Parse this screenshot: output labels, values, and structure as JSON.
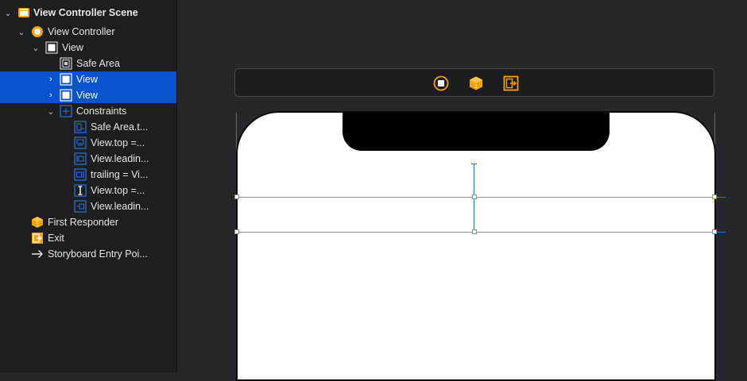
{
  "outline": {
    "items": [
      {
        "label": "View Controller Scene",
        "icon": "scene-icon"
      },
      {
        "label": "View Controller",
        "icon": "view-controller-icon"
      },
      {
        "label": "View",
        "icon": "view-icon"
      },
      {
        "label": "Safe Area",
        "icon": "safe-area-icon"
      },
      {
        "label": "View",
        "icon": "view-icon"
      },
      {
        "label": "View",
        "icon": "view-icon"
      },
      {
        "label": "Constraints",
        "icon": "constraints-icon"
      },
      {
        "label": "Safe Area.t...",
        "icon": "constraint-icon"
      },
      {
        "label": "View.top =...",
        "icon": "constraint-icon"
      },
      {
        "label": "View.leadin...",
        "icon": "constraint-icon"
      },
      {
        "label": "trailing = Vi...",
        "icon": "constraint-icon"
      },
      {
        "label": "View.top =...",
        "icon": "constraint-icon"
      },
      {
        "label": "View.leadin...",
        "icon": "constraint-icon"
      },
      {
        "label": "First Responder",
        "icon": "first-responder-icon"
      },
      {
        "label": "Exit",
        "icon": "exit-icon"
      },
      {
        "label": "Storyboard Entry Poi...",
        "icon": "arrow-right-icon"
      }
    ]
  },
  "scene_bar": {
    "icons": [
      "view-controller-icon",
      "first-responder-icon",
      "exit-icon"
    ]
  },
  "colors": {
    "selection": "#0a53cf",
    "accent_orange": "#f2a20d",
    "constraint_blue": "#2d74da"
  }
}
